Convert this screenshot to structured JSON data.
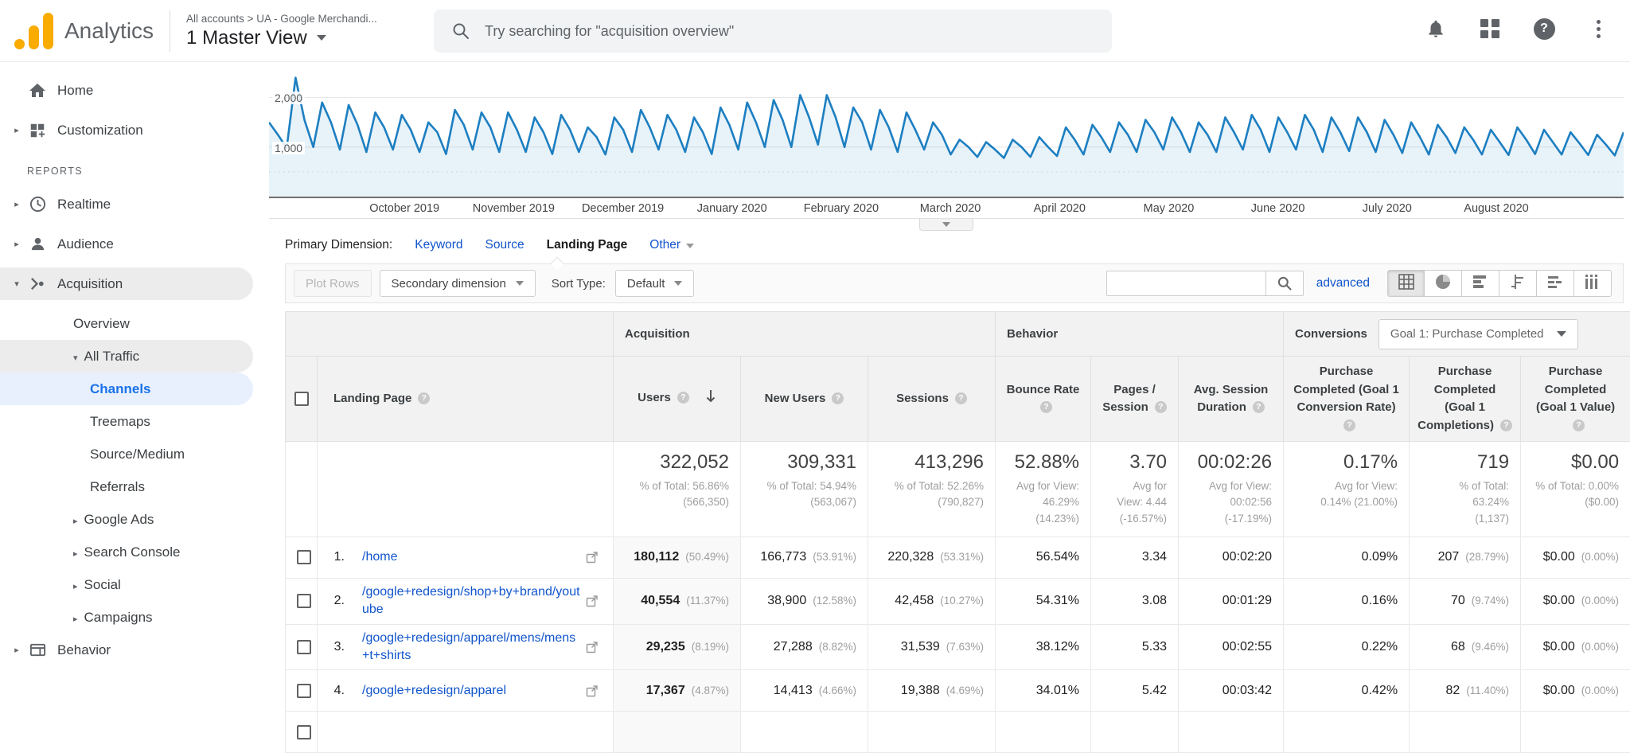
{
  "app": {
    "product": "Analytics",
    "breadcrumb": "All accounts > UA - Google Merchandi...",
    "view_name": "1 Master View",
    "search_placeholder": "Try searching for \"acquisition overview\"",
    "top_icons": [
      "bell-icon",
      "apps-grid-icon",
      "help-icon",
      "more-vert-icon"
    ],
    "help_glyph": "?"
  },
  "sidebar": {
    "section_label": "REPORTS",
    "items": [
      {
        "id": "home",
        "label": "Home",
        "icon": "home",
        "level": 0,
        "arrow": ""
      },
      {
        "id": "customization",
        "label": "Customization",
        "icon": "customization",
        "level": 0,
        "arrow": "right"
      },
      {
        "id": "reports",
        "label": "REPORTS",
        "type": "section"
      },
      {
        "id": "realtime",
        "label": "Realtime",
        "icon": "realtime",
        "level": 0,
        "arrow": "right"
      },
      {
        "id": "audience",
        "label": "Audience",
        "icon": "audience",
        "level": 0,
        "arrow": "right"
      },
      {
        "id": "acquisition",
        "label": "Acquisition",
        "icon": "acquisition",
        "level": 0,
        "arrow": "down",
        "pill": "gray"
      },
      {
        "id": "overview",
        "label": "Overview",
        "level": 1,
        "arrow": ""
      },
      {
        "id": "all-traffic",
        "label": "All Traffic",
        "level": 1,
        "arrow": "down",
        "pill": "gray"
      },
      {
        "id": "channels",
        "label": "Channels",
        "level": 2,
        "arrow": "",
        "pill": "blue",
        "selected": true
      },
      {
        "id": "treemaps",
        "label": "Treemaps",
        "level": 2,
        "arrow": ""
      },
      {
        "id": "source-medium",
        "label": "Source/Medium",
        "level": 2,
        "arrow": ""
      },
      {
        "id": "referrals",
        "label": "Referrals",
        "level": 2,
        "arrow": ""
      },
      {
        "id": "google-ads",
        "label": "Google Ads",
        "level": 1,
        "arrow": "right"
      },
      {
        "id": "search-console",
        "label": "Search Console",
        "level": 1,
        "arrow": "right"
      },
      {
        "id": "social",
        "label": "Social",
        "level": 1,
        "arrow": "right"
      },
      {
        "id": "campaigns",
        "label": "Campaigns",
        "level": 1,
        "arrow": "right"
      },
      {
        "id": "behavior",
        "label": "Behavior",
        "icon": "behavior",
        "level": 0,
        "arrow": "right"
      }
    ]
  },
  "chart_data": {
    "type": "line",
    "title": "",
    "xlabel": "",
    "ylabel": "",
    "x_tick_labels": [
      "October 2019",
      "November 2019",
      "December 2019",
      "January 2020",
      "February 2020",
      "March 2020",
      "April 2020",
      "May 2020",
      "June 2020",
      "July 2020",
      "August 2020"
    ],
    "y_ticks": [
      {
        "value": 2000,
        "label": "2,000"
      },
      {
        "value": 1000,
        "label": "1,000"
      }
    ],
    "y_minor_ticks": [
      500
    ],
    "ylim": [
      0,
      2700
    ],
    "line_color": "#1d7fc1",
    "area_color": "rgba(29,127,193,0.10)",
    "values": [
      1500,
      1250,
      980,
      2400,
      1550,
      1000,
      1900,
      1500,
      950,
      1850,
      1450,
      900,
      1700,
      1400,
      950,
      1650,
      1350,
      900,
      1500,
      1300,
      860,
      1750,
      1450,
      950,
      1700,
      1400,
      900,
      1700,
      1350,
      900,
      1600,
      1300,
      860,
      1650,
      1350,
      900,
      1400,
      1200,
      850,
      1600,
      1350,
      900,
      1750,
      1400,
      950,
      1650,
      1350,
      900,
      1600,
      1300,
      860,
      1800,
      1450,
      950,
      1900,
      1500,
      1000,
      1950,
      1550,
      1000,
      2050,
      1600,
      1050,
      2050,
      1600,
      1000,
      1800,
      1500,
      950,
      1750,
      1400,
      900,
      1700,
      1350,
      950,
      1500,
      1250,
      850,
      1150,
      1000,
      800,
      1100,
      950,
      780,
      1150,
      1000,
      800,
      1200,
      1000,
      820,
      1400,
      1150,
      850,
      1450,
      1200,
      900,
      1500,
      1250,
      900,
      1550,
      1300,
      950,
      1600,
      1300,
      900,
      1500,
      1250,
      900,
      1600,
      1300,
      950,
      1650,
      1350,
      900,
      1600,
      1300,
      950,
      1650,
      1350,
      900,
      1600,
      1300,
      920,
      1600,
      1300,
      900,
      1550,
      1250,
      880,
      1500,
      1200,
      850,
      1450,
      1200,
      880,
      1400,
      1150,
      850,
      1350,
      1100,
      840,
      1400,
      1150,
      860,
      1350,
      1100,
      850,
      1300,
      1080,
      840,
      1250,
      1050,
      830,
      1300
    ]
  },
  "report": {
    "primary_dimension": {
      "label": "Primary Dimension:",
      "options": [
        {
          "label": "Keyword",
          "state": "link"
        },
        {
          "label": "Source",
          "state": "link"
        },
        {
          "label": "Landing Page",
          "state": "selected"
        },
        {
          "label": "Other",
          "state": "dropdown"
        }
      ]
    },
    "toolbar": {
      "plot_rows": "Plot Rows",
      "secondary_dimension": "Secondary dimension",
      "sort_type_label": "Sort Type:",
      "sort_type_value": "Default",
      "search_value": "",
      "advanced_label": "advanced",
      "views": [
        "table",
        "percentage",
        "performance",
        "comparison",
        "term-cloud",
        "pivot"
      ],
      "active_view": "table"
    },
    "table": {
      "groups": [
        {
          "label": "Acquisition",
          "span": 3
        },
        {
          "label": "Behavior",
          "span": 3
        },
        {
          "label": "Conversions",
          "span": 3,
          "goal_selector": "Goal 1: Purchase Completed"
        }
      ],
      "columns": [
        {
          "id": "landing_page",
          "label": "Landing Page",
          "help": true
        },
        {
          "id": "users",
          "label": "Users",
          "help": true,
          "sorted": "desc"
        },
        {
          "id": "new_users",
          "label": "New Users",
          "help": true
        },
        {
          "id": "sessions",
          "label": "Sessions",
          "help": true
        },
        {
          "id": "bounce_rate",
          "label": "Bounce Rate",
          "help": true
        },
        {
          "id": "pages_session",
          "label": "Pages / Session",
          "help": true
        },
        {
          "id": "avg_session_duration",
          "label": "Avg. Session Duration",
          "help": true
        },
        {
          "id": "goal_conversion_rate",
          "label": "Purchase Completed (Goal 1 Conversion Rate)",
          "help": true
        },
        {
          "id": "goal_completions",
          "label": "Purchase Completed (Goal 1 Completions)",
          "help": true
        },
        {
          "id": "goal_value",
          "label": "Purchase Completed (Goal 1 Value)",
          "help": true
        }
      ],
      "totals": [
        {
          "main": "322,052",
          "sub": "% of Total: 56.86%\n(566,350)"
        },
        {
          "main": "309,331",
          "sub": "% of Total: 54.94%\n(563,067)"
        },
        {
          "main": "413,296",
          "sub": "% of Total: 52.26%\n(790,827)"
        },
        {
          "main": "52.88%",
          "sub": "Avg for View:\n46.29%\n(14.23%)"
        },
        {
          "main": "3.70",
          "sub": "Avg for\nView: 4.44\n(-16.57%)"
        },
        {
          "main": "00:02:26",
          "sub": "Avg for View:\n00:02:56\n(-17.19%)"
        },
        {
          "main": "0.17%",
          "sub": "Avg for View:\n0.14% (21.00%)"
        },
        {
          "main": "719",
          "sub": "% of Total: 63.24%\n(1,137)"
        },
        {
          "main": "$0.00",
          "sub": "% of Total: 0.00%\n($0.00)"
        }
      ],
      "rows": [
        {
          "num": "1.",
          "page": "/home",
          "cells": [
            [
              "180,112",
              "(50.49%)"
            ],
            [
              "166,773",
              "(53.91%)"
            ],
            [
              "220,328",
              "(53.31%)"
            ],
            [
              "56.54%"
            ],
            [
              "3.34"
            ],
            [
              "00:02:20"
            ],
            [
              "0.09%"
            ],
            [
              "207",
              "(28.79%)"
            ],
            [
              "$0.00",
              "(0.00%)"
            ]
          ]
        },
        {
          "num": "2.",
          "page": "/google+redesign/shop+by+brand/youtube",
          "cells": [
            [
              "40,554",
              "(11.37%)"
            ],
            [
              "38,900",
              "(12.58%)"
            ],
            [
              "42,458",
              "(10.27%)"
            ],
            [
              "54.31%"
            ],
            [
              "3.08"
            ],
            [
              "00:01:29"
            ],
            [
              "0.16%"
            ],
            [
              "70",
              "(9.74%)"
            ],
            [
              "$0.00",
              "(0.00%)"
            ]
          ]
        },
        {
          "num": "3.",
          "page": "/google+redesign/apparel/mens/mens+t+shirts",
          "cells": [
            [
              "29,235",
              "(8.19%)"
            ],
            [
              "27,288",
              "(8.82%)"
            ],
            [
              "31,539",
              "(7.63%)"
            ],
            [
              "38.12%"
            ],
            [
              "5.33"
            ],
            [
              "00:02:55"
            ],
            [
              "0.22%"
            ],
            [
              "68",
              "(9.46%)"
            ],
            [
              "$0.00",
              "(0.00%)"
            ]
          ]
        },
        {
          "num": "4.",
          "page": "/google+redesign/apparel",
          "cells": [
            [
              "17,367",
              "(4.87%)"
            ],
            [
              "14,413",
              "(4.66%)"
            ],
            [
              "19,388",
              "(4.69%)"
            ],
            [
              "34.01%"
            ],
            [
              "5.42"
            ],
            [
              "00:03:42"
            ],
            [
              "0.42%"
            ],
            [
              "82",
              "(11.40%)"
            ],
            [
              "$0.00",
              "(0.00%)"
            ]
          ]
        }
      ]
    }
  }
}
